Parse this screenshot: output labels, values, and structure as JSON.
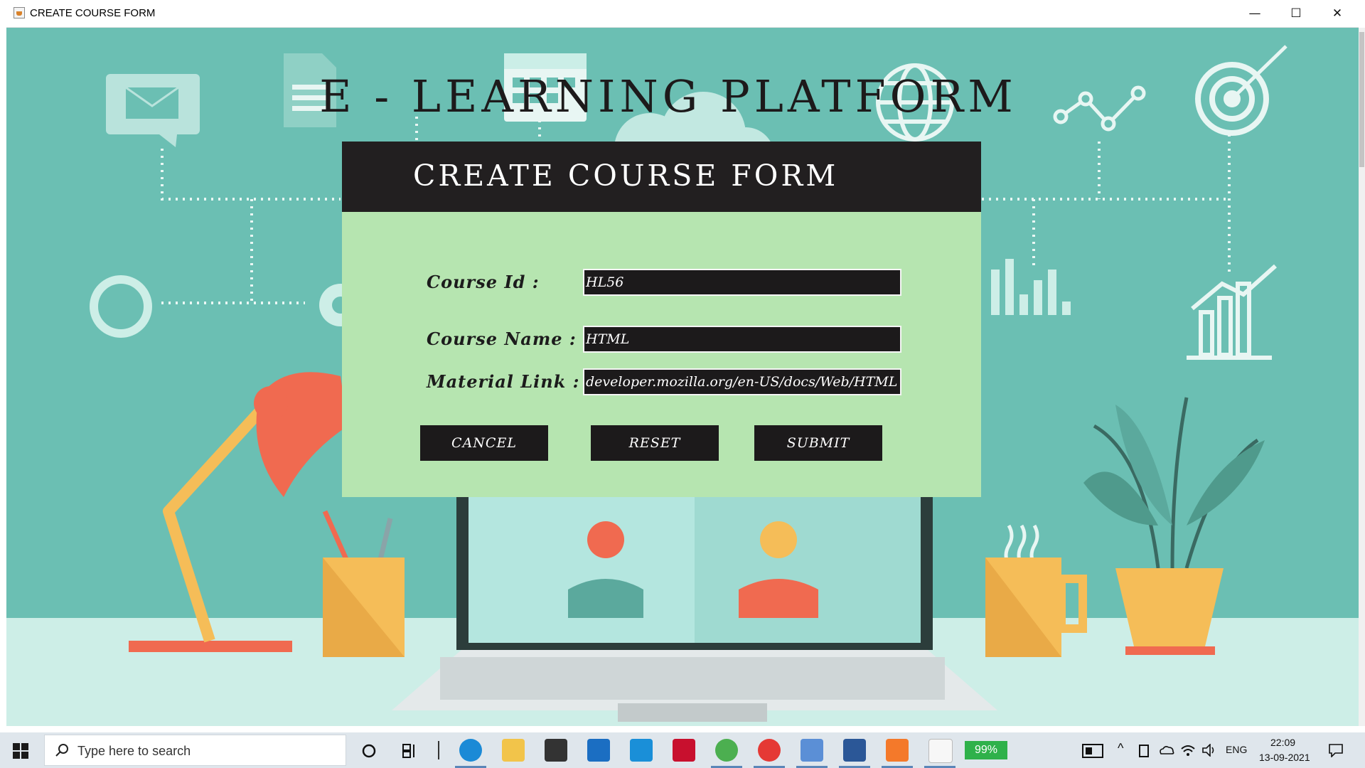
{
  "window": {
    "title": "CREATE COURSE FORM",
    "minimize_glyph": "—",
    "maximize_glyph": "☐",
    "close_glyph": "✕"
  },
  "app": {
    "platform_title": "E - LEARNING PLATFORM",
    "form_title": "CREATE COURSE FORM",
    "fields": {
      "course_id": {
        "label": "Course Id :",
        "value": "HL56"
      },
      "course_name": {
        "label": "Course Name :",
        "value": "HTML"
      },
      "material_link": {
        "label": "Material Link :",
        "value": "developer.mozilla.org/en-US/docs/Web/HTML"
      }
    },
    "buttons": {
      "cancel": "CANCEL",
      "reset": "RESET",
      "submit": "SUBMIT"
    }
  },
  "taskbar": {
    "search_placeholder": "Type here to search",
    "apps": [
      "cortana-icon",
      "task-view-icon",
      "edge-icon",
      "file-explorer-icon",
      "store-icon",
      "mail-icon",
      "l-app-icon",
      "mcafee-icon",
      "chrome-icon",
      "chrome-profile-icon",
      "virtualbox-icon",
      "word-icon",
      "xampp-icon",
      "java-icon"
    ],
    "battery": "99%",
    "language": "ENG",
    "time": "22:09",
    "date": "13-09-2021"
  },
  "colors": {
    "background": "#6bbfb3",
    "form_header": "#221f20",
    "form_body": "#b6e5b0",
    "input_bg": "#1c1a1b",
    "button_bg": "#1c1a1b"
  }
}
